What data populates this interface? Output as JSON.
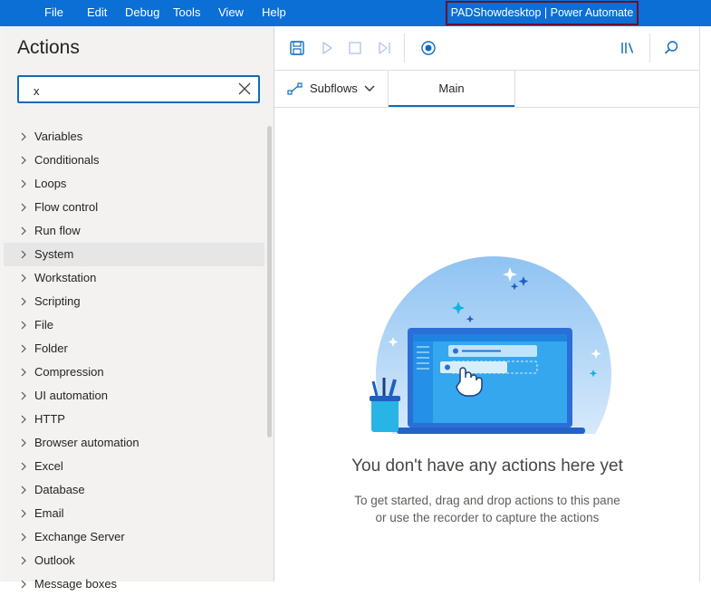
{
  "menu": {
    "items": [
      "File",
      "Edit",
      "Debug",
      "Tools",
      "View",
      "Help"
    ]
  },
  "window_title": "PADShowdesktop | Power Automate",
  "actions_pane": {
    "title": "Actions",
    "search": {
      "value": "x",
      "placeholder": ""
    },
    "items": [
      "Variables",
      "Conditionals",
      "Loops",
      "Flow control",
      "Run flow",
      "System",
      "Workstation",
      "Scripting",
      "File",
      "Folder",
      "Compression",
      "UI automation",
      "HTTP",
      "Browser automation",
      "Excel",
      "Database",
      "Email",
      "Exchange Server",
      "Outlook",
      "Message boxes"
    ],
    "highlighted_item": "System"
  },
  "toolbar": {
    "buttons": [
      "save-icon",
      "run-icon",
      "stop-icon",
      "step-icon",
      "record-icon",
      "variables-icon",
      "search-icon"
    ]
  },
  "tabs": {
    "subflows_label": "Subflows",
    "main_label": "Main"
  },
  "empty_state": {
    "title": "You don't have any actions here yet",
    "line1": "To get started, drag and drop actions to this pane",
    "line2": "or use the recorder to capture the actions"
  },
  "colors": {
    "menubar": "#0b6fd6",
    "accent": "#0f6cbd",
    "title_highlight_border": "#6e0f2c"
  }
}
